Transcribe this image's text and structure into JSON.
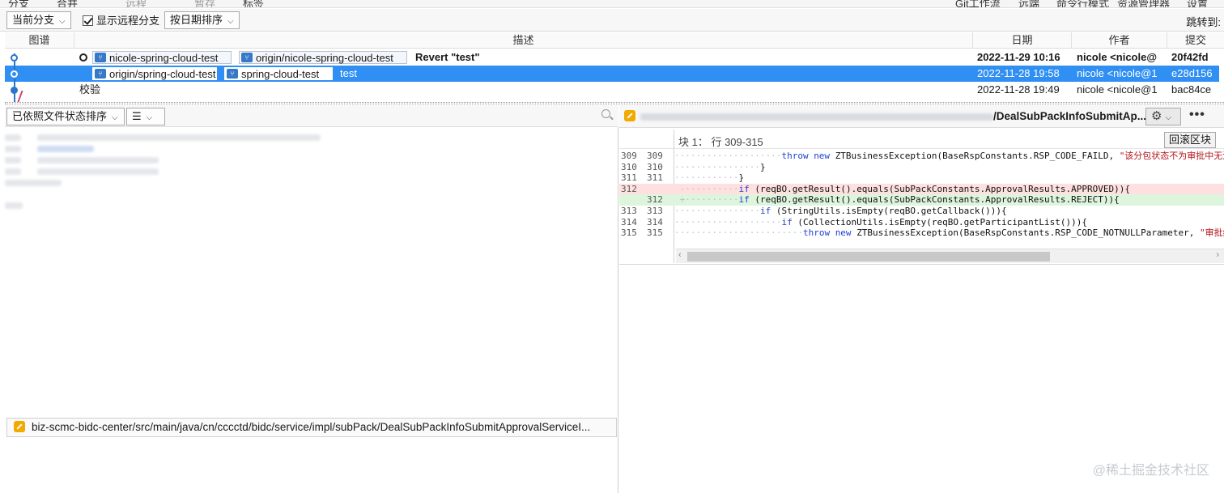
{
  "top_menu": [
    "分支",
    "合并",
    "远程",
    "暂存",
    "标签",
    "Git工作流",
    "远端",
    "命令行模式",
    "资源管理器",
    "设置"
  ],
  "toolbar": {
    "branch_filter": "当前分支",
    "show_remote_checked": true,
    "show_remote_label": "显示远程分支",
    "sort_by": "按日期排序",
    "jump_to": "跳转到:"
  },
  "log": {
    "columns": [
      "图谱",
      "描述",
      "日期",
      "作者",
      "提交"
    ],
    "rows": [
      {
        "badges": [
          "nicole-spring-cloud-test",
          "origin/nicole-spring-cloud-test"
        ],
        "head_marker": true,
        "message": "Revert \"test\"",
        "date": "2022-11-29 10:16",
        "author": "nicole <nicole@",
        "commit": "20f42fd",
        "bold": true,
        "selected": false
      },
      {
        "badges": [
          "origin/spring-cloud-test",
          "spring-cloud-test"
        ],
        "head_marker": false,
        "message": "test",
        "date": "2022-11-28 19:58",
        "author": "nicole <nicole@1",
        "commit": "e28d156",
        "bold": false,
        "selected": true
      },
      {
        "badges": [],
        "head_marker": false,
        "message": "校验",
        "date": "2022-11-28 19:49",
        "author": "nicole <nicole@1",
        "commit": "bac84ce",
        "bold": false,
        "selected": false
      }
    ]
  },
  "files_panel": {
    "sort_label": "已依照文件状态排序",
    "view_icon": "list-icon",
    "file_path": "biz-scmc-bidc-center/src/main/java/cn/cccctd/bidc/service/impl/subPack/DealSubPackInfoSubmitApprovalServiceI..."
  },
  "diff_panel": {
    "file_name_tail": "/DealSubPackInfoSubmitAp...",
    "hunk_label": "块 1： 行 309-315",
    "rollback_label": "回滚区块",
    "lines": [
      {
        "old": "309",
        "new": "309",
        "type": "ctx",
        "marker": "",
        "indent": "····················",
        "parts": [
          [
            "kw",
            "throw new "
          ],
          [
            "",
            "ZTBusinessException(BaseRspConstants.RSP_CODE_FAILD, "
          ],
          [
            "str",
            "\"该分包状态不为审批中无法"
          ]
        ]
      },
      {
        "old": "310",
        "new": "310",
        "type": "ctx",
        "marker": "",
        "indent": "················",
        "parts": [
          [
            "",
            "}"
          ]
        ]
      },
      {
        "old": "311",
        "new": "311",
        "type": "ctx",
        "marker": "",
        "indent": "············",
        "parts": [
          [
            "",
            "}"
          ]
        ]
      },
      {
        "old": "312",
        "new": "",
        "type": "del",
        "marker": "-",
        "indent": "············",
        "parts": [
          [
            "kw",
            "if "
          ],
          [
            "",
            "(reqBO.getResult().equals(SubPackConstants.ApprovalResults.APPROVED)){"
          ]
        ]
      },
      {
        "old": "",
        "new": "312",
        "type": "add",
        "marker": "+",
        "indent": "············",
        "parts": [
          [
            "kw",
            "if "
          ],
          [
            "",
            "(reqBO.getResult().equals(SubPackConstants.ApprovalResults.REJECT)){"
          ]
        ]
      },
      {
        "old": "313",
        "new": "313",
        "type": "ctx",
        "marker": "",
        "indent": "················",
        "parts": [
          [
            "kw",
            "if "
          ],
          [
            "",
            "(StringUtils.isEmpty(reqBO.getCallback())){"
          ]
        ]
      },
      {
        "old": "314",
        "new": "314",
        "type": "ctx",
        "marker": "",
        "indent": "····················",
        "parts": [
          [
            "kw",
            "if "
          ],
          [
            "",
            "(CollectionUtils.isEmpty(reqBO.getParticipantList())){"
          ]
        ]
      },
      {
        "old": "315",
        "new": "315",
        "type": "ctx",
        "marker": "",
        "indent": "························",
        "parts": [
          [
            "kw",
            "throw new "
          ],
          [
            "",
            "ZTBusinessException(BaseRspConstants.RSP_CODE_NOTNULLParameter, "
          ],
          [
            "str",
            "\"审批结果"
          ]
        ]
      }
    ]
  },
  "watermark": "@稀土掘金技术社区",
  "colors": {
    "selection": "#2f8ff2",
    "graph": "#2b76c9",
    "deleted_bg": "#ffe0e0",
    "added_bg": "#ddf5dd"
  }
}
